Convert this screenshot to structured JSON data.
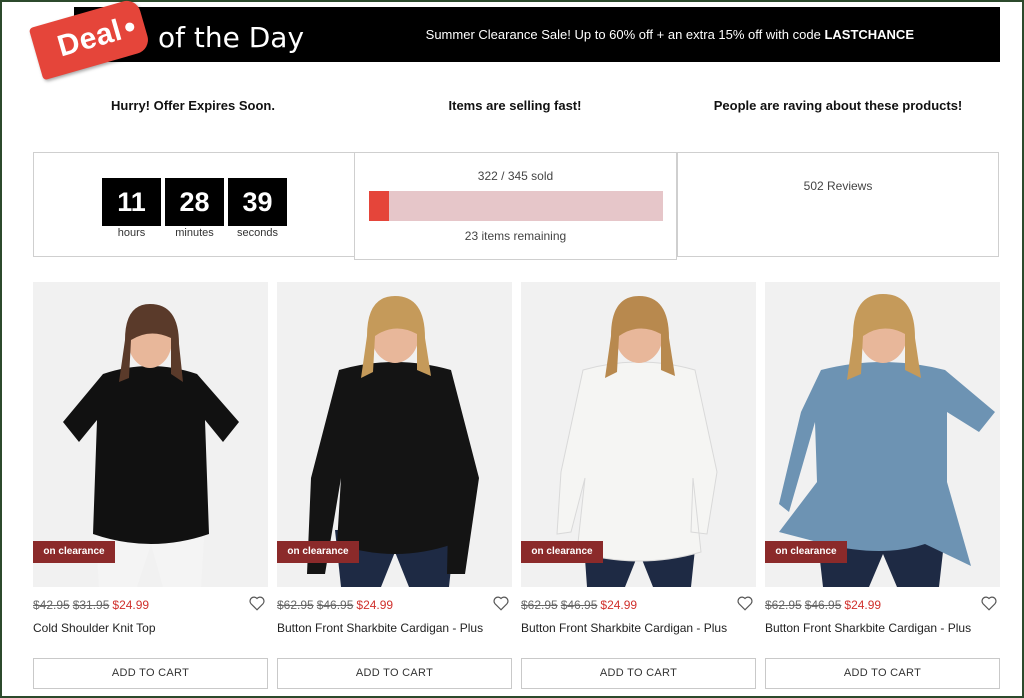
{
  "banner": {
    "deal_label": "Deal",
    "of_the_day": "of the Day",
    "promo_text": "Summer Clearance Sale! Up to 60% off + an extra 15% off with code ",
    "promo_code": "LASTCHANCE"
  },
  "headlines": {
    "expires": "Hurry! Offer Expires Soon.",
    "selling": "Items are selling fast!",
    "raving": "People are raving about these products!"
  },
  "countdown": {
    "hours": "11",
    "hours_label": "hours",
    "minutes": "28",
    "minutes_label": "minutes",
    "seconds": "39",
    "seconds_label": "seconds"
  },
  "stock": {
    "sold_text": "322 / 345 sold",
    "remaining_text": "23 items remaining",
    "remaining_fraction": 0.067
  },
  "reviews": {
    "text": "502 Reviews"
  },
  "colors": {
    "accent": "#e5453a",
    "badge": "#8b2a2a",
    "sale_price": "#d0312d",
    "bar_bg": "#e6c6c9"
  },
  "products": [
    {
      "badge": "on clearance",
      "orig1": "$42.95",
      "orig2": "$31.95",
      "sale": "$24.99",
      "name": "Cold Shoulder Knit Top",
      "cta": "ADD TO CART",
      "garment": "#111111",
      "pants": "#f4f4f4",
      "hair": "#5a3a2a"
    },
    {
      "badge": "on clearance",
      "orig1": "$62.95",
      "orig2": "$46.95",
      "sale": "$24.99",
      "name": "Button Front Sharkbite Cardigan - Plus",
      "cta": "ADD TO CART",
      "garment": "#141414",
      "pants": "#1e2a44",
      "hair": "#c59a5a"
    },
    {
      "badge": "on clearance",
      "orig1": "$62.95",
      "orig2": "$46.95",
      "sale": "$24.99",
      "name": "Button Front Sharkbite Cardigan - Plus",
      "cta": "ADD TO CART",
      "garment": "#f5f5f3",
      "pants": "#1e2a44",
      "hair": "#b8894e"
    },
    {
      "badge": "on clearance",
      "orig1": "$62.95",
      "orig2": "$46.95",
      "sale": "$24.99",
      "name": "Button Front Sharkbite Cardigan - Plus",
      "cta": "ADD TO CART",
      "garment": "#6d93b3",
      "pants": "#1e2a44",
      "hair": "#c59a5a"
    }
  ]
}
